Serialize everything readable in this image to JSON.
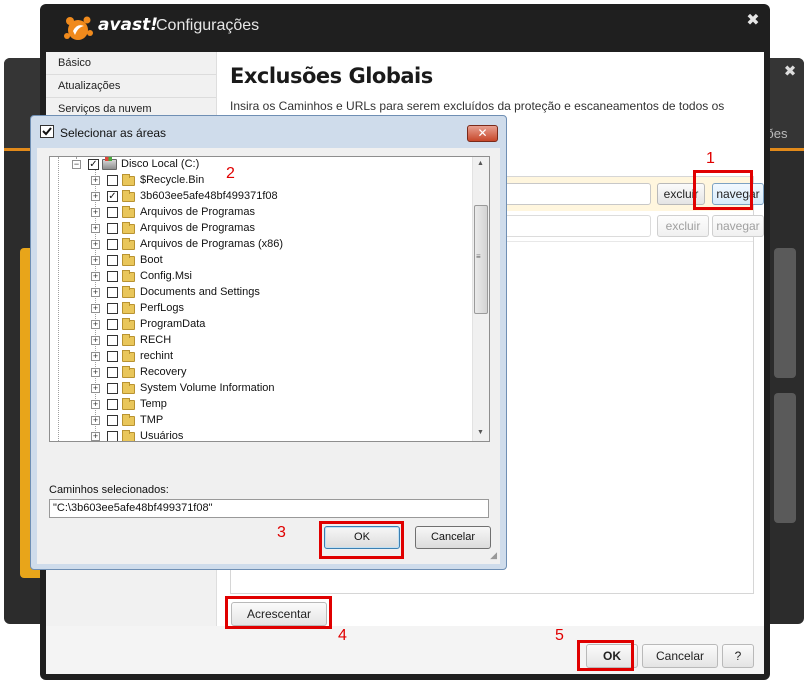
{
  "background": {
    "tab_text": "ções"
  },
  "config_window": {
    "brand": "avast!",
    "title": "Configurações",
    "close": "✖",
    "sidebar": [
      "Básico",
      "Atualizações",
      "Serviços da nuvem"
    ],
    "heading": "Exclusões Globais",
    "description": "Insira os Caminhos e URLs para serem excluídos da proteção e escaneamentos de todos os",
    "rows": [
      {
        "excluir": "excluir",
        "navegar": "navegar",
        "enabled": true
      },
      {
        "excluir": "excluir",
        "navegar": "navegar",
        "enabled": false
      }
    ],
    "add_button": "Acrescentar",
    "ok_button": "OK",
    "cancel_button": "Cancelar",
    "help_button": "?"
  },
  "select_dialog": {
    "title": "Selecionar as áreas",
    "close": "✕",
    "root": {
      "label": "Disco Local (C:)",
      "checked": true
    },
    "items": [
      {
        "label": "$Recycle.Bin",
        "checked": false
      },
      {
        "label": "3b603ee5afe48bf499371f08",
        "checked": true
      },
      {
        "label": "Arquivos de Programas",
        "checked": false
      },
      {
        "label": "Arquivos de Programas",
        "checked": false
      },
      {
        "label": "Arquivos de Programas (x86)",
        "checked": false
      },
      {
        "label": "Boot",
        "checked": false
      },
      {
        "label": "Config.Msi",
        "checked": false
      },
      {
        "label": "Documents and Settings",
        "checked": false
      },
      {
        "label": "PerfLogs",
        "checked": false
      },
      {
        "label": "ProgramData",
        "checked": false
      },
      {
        "label": "RECH",
        "checked": false
      },
      {
        "label": "rechint",
        "checked": false
      },
      {
        "label": "Recovery",
        "checked": false
      },
      {
        "label": "System Volume Information",
        "checked": false
      },
      {
        "label": "Temp",
        "checked": false
      },
      {
        "label": "TMP",
        "checked": false
      },
      {
        "label": "Usuários",
        "checked": false
      }
    ],
    "selected_label": "Caminhos selecionados:",
    "selected_value": "\"C:\\3b603ee5afe48bf499371f08\"",
    "ok_button": "OK",
    "cancel_button": "Cancelar"
  },
  "annotations": {
    "n1": "1",
    "n2": "2",
    "n3": "3",
    "n4": "4",
    "n5": "5",
    "color": "#e00000"
  }
}
